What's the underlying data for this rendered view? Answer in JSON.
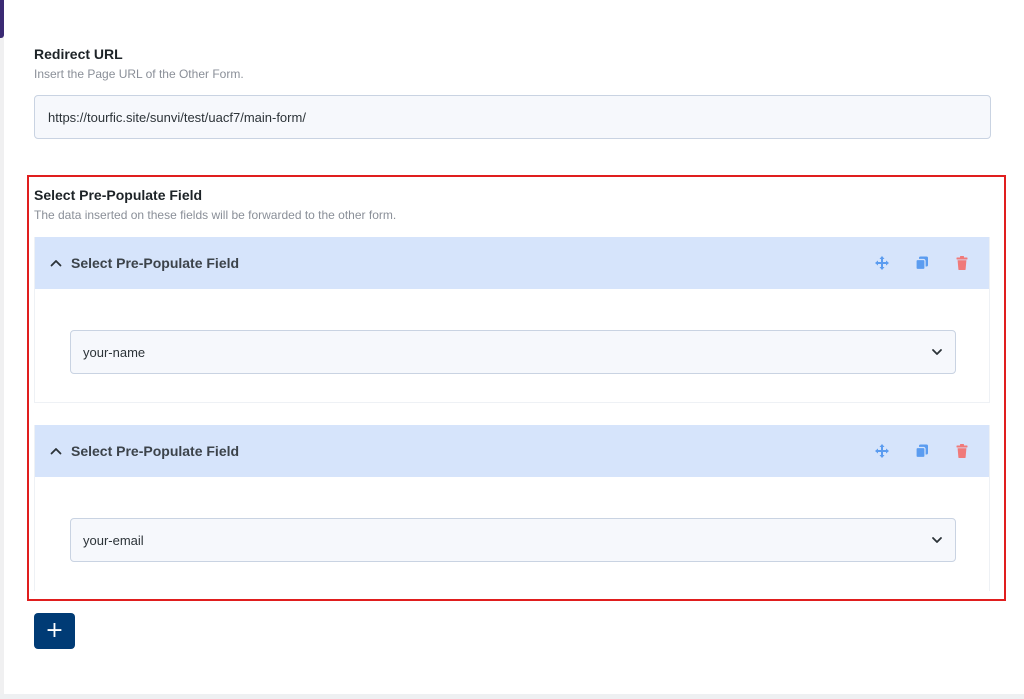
{
  "redirect": {
    "title": "Redirect URL",
    "description": "Insert the Page URL of the Other Form.",
    "url_value": "https://tourfic.site/sunvi/test/uacf7/main-form/"
  },
  "prepopulate": {
    "title": "Select Pre-Populate Field",
    "description": "The data inserted on these fields will be forwarded to the other form.",
    "items": [
      {
        "header": "Select Pre-Populate Field",
        "selected": "your-name"
      },
      {
        "header": "Select Pre-Populate Field",
        "selected": "your-email"
      }
    ],
    "add_label": "+"
  },
  "icons": {
    "collapse": "chevron-up-icon",
    "move": "move-arrows-icon",
    "duplicate": "copy-icon",
    "delete": "trash-icon",
    "dropdown": "chevron-down-icon"
  },
  "colors": {
    "accent_icon": "#5b9cf0",
    "delete_icon": "#f07a7a",
    "header_bg": "#d6e4fb",
    "add_button": "#003b75",
    "highlight": "#e01e1e"
  }
}
